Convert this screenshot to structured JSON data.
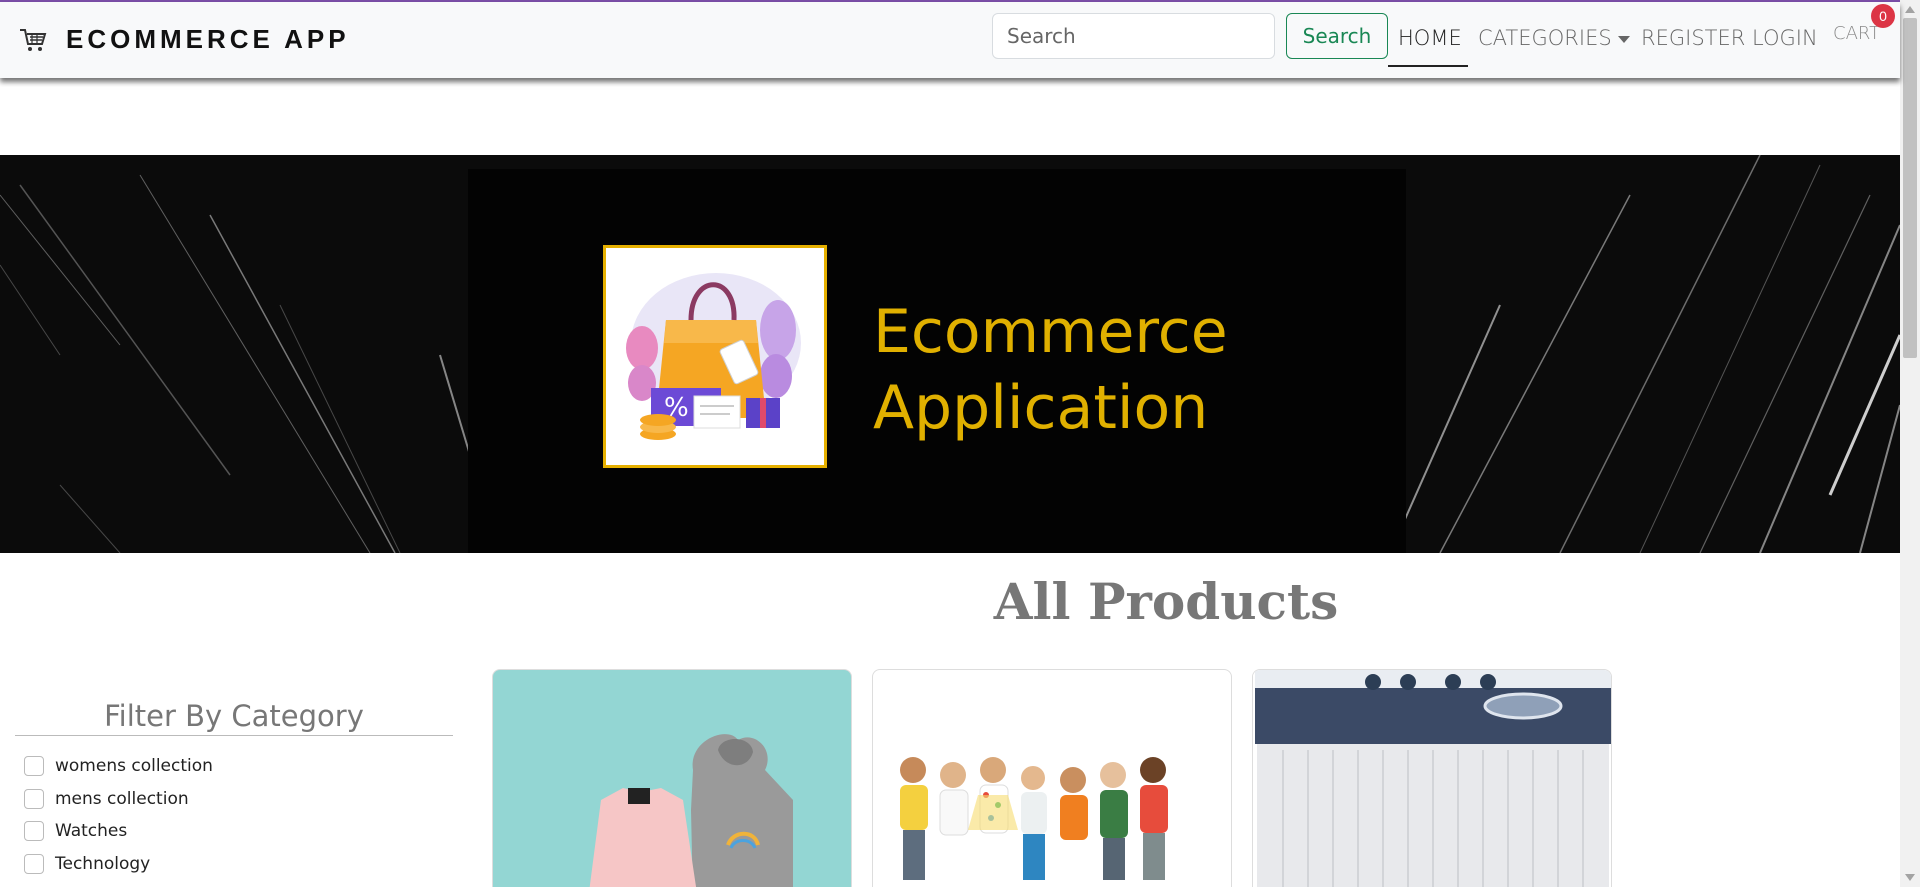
{
  "brand": {
    "name": "ECOMMERCE APP",
    "icon": "shopping-cart-icon"
  },
  "search": {
    "placeholder": "Search",
    "button_label": "Search"
  },
  "nav": {
    "home": "HOME",
    "categories": "CATEGORIES",
    "register": "REGISTER",
    "login": "LOGIN",
    "cart": "CART",
    "cart_count": "0"
  },
  "banner": {
    "title_line1": "Ecommerce",
    "title_line2": "Application"
  },
  "products": {
    "heading": "All Products"
  },
  "filter": {
    "title": "Filter By Category",
    "categories": [
      "womens collection",
      "mens collection",
      "Watches",
      "Technology"
    ]
  },
  "colors": {
    "accent_green": "#198754",
    "badge_red": "#dc3545",
    "banner_gold": "#e0b000",
    "top_accent": "#7b4fa8"
  }
}
